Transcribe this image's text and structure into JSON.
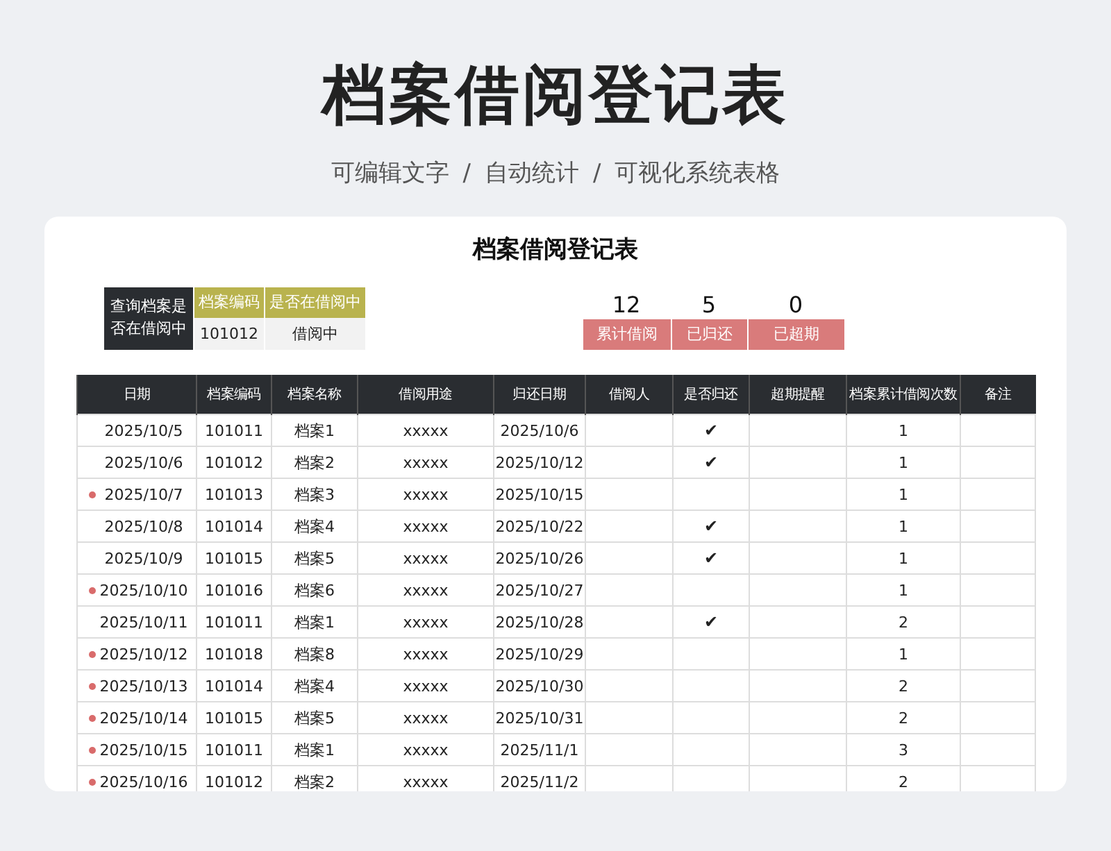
{
  "title": "档案借阅登记表",
  "subtitle": [
    "可编辑文字",
    "/",
    "自动统计",
    "/",
    "可视化系统表格"
  ],
  "sheet": {
    "title": "档案借阅登记表",
    "query": {
      "label": "查询档案是否在借阅中",
      "columns": [
        {
          "heading": "档案编码",
          "value": "101012"
        },
        {
          "heading": "是否在借阅中",
          "value": "借阅中"
        }
      ]
    },
    "stats": [
      {
        "value": "12",
        "label": "累计借阅"
      },
      {
        "value": "5",
        "label": "已归还"
      },
      {
        "value": "0",
        "label": "已超期"
      }
    ],
    "table": {
      "columns": [
        "日期",
        "档案编码",
        "档案名称",
        "借阅用途",
        "归还日期",
        "借阅人",
        "是否归还",
        "超期提醒",
        "档案累计借阅次数",
        "备注"
      ],
      "rows": [
        {
          "flagged": false,
          "date": "2025/10/5",
          "code": "101011",
          "name": "档案1",
          "purpose": "xxxxx",
          "return_date": "2025/10/6",
          "returned": "✔",
          "count": "1"
        },
        {
          "flagged": false,
          "date": "2025/10/6",
          "code": "101012",
          "name": "档案2",
          "purpose": "xxxxx",
          "return_date": "2025/10/12",
          "returned": "✔",
          "count": "1"
        },
        {
          "flagged": true,
          "date": "2025/10/7",
          "code": "101013",
          "name": "档案3",
          "purpose": "xxxxx",
          "return_date": "2025/10/15",
          "count": "1"
        },
        {
          "flagged": false,
          "date": "2025/10/8",
          "code": "101014",
          "name": "档案4",
          "purpose": "xxxxx",
          "return_date": "2025/10/22",
          "returned": "✔",
          "count": "1"
        },
        {
          "flagged": false,
          "date": "2025/10/9",
          "code": "101015",
          "name": "档案5",
          "purpose": "xxxxx",
          "return_date": "2025/10/26",
          "returned": "✔",
          "count": "1"
        },
        {
          "flagged": true,
          "date": "2025/10/10",
          "code": "101016",
          "name": "档案6",
          "purpose": "xxxxx",
          "return_date": "2025/10/27",
          "count": "1"
        },
        {
          "flagged": false,
          "date": "2025/10/11",
          "code": "101011",
          "name": "档案1",
          "purpose": "xxxxx",
          "return_date": "2025/10/28",
          "returned": "✔",
          "count": "2"
        },
        {
          "flagged": true,
          "date": "2025/10/12",
          "code": "101018",
          "name": "档案8",
          "purpose": "xxxxx",
          "return_date": "2025/10/29",
          "count": "1"
        },
        {
          "flagged": true,
          "date": "2025/10/13",
          "code": "101014",
          "name": "档案4",
          "purpose": "xxxxx",
          "return_date": "2025/10/30",
          "count": "2"
        },
        {
          "flagged": true,
          "date": "2025/10/14",
          "code": "101015",
          "name": "档案5",
          "purpose": "xxxxx",
          "return_date": "2025/10/31",
          "count": "2"
        },
        {
          "flagged": true,
          "date": "2025/10/15",
          "code": "101011",
          "name": "档案1",
          "purpose": "xxxxx",
          "return_date": "2025/11/1",
          "count": "3"
        },
        {
          "flagged": true,
          "date": "2025/10/16",
          "code": "101012",
          "name": "档案2",
          "purpose": "xxxxx",
          "return_date": "2025/11/2",
          "count": "2"
        }
      ]
    }
  }
}
